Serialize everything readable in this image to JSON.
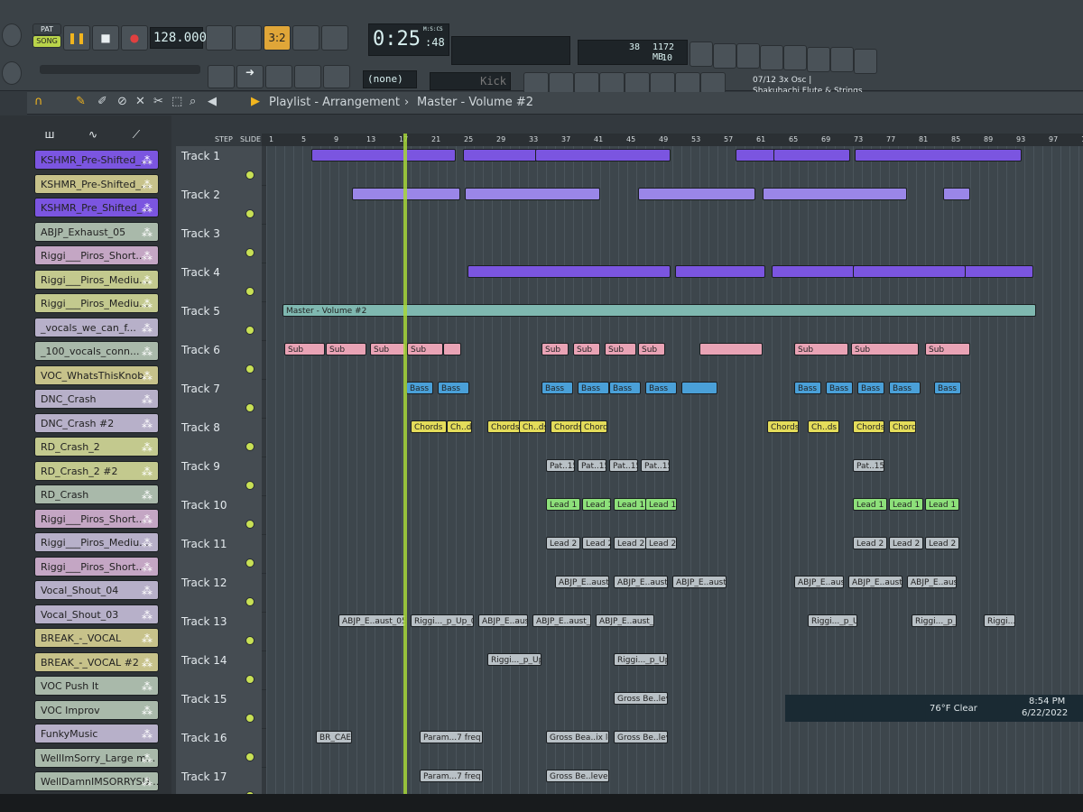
{
  "toolbar": {
    "pat_label": "PAT",
    "song_label": "SONG",
    "tempo": "128.000",
    "time": "0:25",
    "time_ms": ":48",
    "time_unit": "M:S:CS",
    "cpu_value": "38",
    "memory": "1172 MB",
    "polyphony": "10",
    "pattern_select": "(none)",
    "channel_name": "Kick",
    "hint_line1": "07/12  3x Osc |",
    "hint_line2": "Shakuhachi Flute & Strings",
    "step_label": "STEP",
    "slide_label": "SLIDE"
  },
  "playlist": {
    "title": "Playlist - Arrangement",
    "breadcrumb": "Master - Volume #2"
  },
  "browser": {
    "channels": [
      {
        "label": "KSHMR_Pre-Shifted_...",
        "color": "#7b55e0"
      },
      {
        "label": "KSHMR_Pre-Shifted_...",
        "color": "#c7c28a"
      },
      {
        "label": "KSHMR_Pre_Shifted_...",
        "color": "#7b55e0"
      },
      {
        "label": "ABJP_Exhaust_05",
        "color": "#a9b9aa"
      },
      {
        "label": "Riggi___Piros_Short...",
        "color": "#c4a6c4"
      },
      {
        "label": "Riggi___Piros_Mediu...",
        "color": "#c3c98e"
      },
      {
        "label": "Riggi___Piros_Mediu...",
        "color": "#c3c98e"
      },
      {
        "label": "_vocals_we_can_f...",
        "color": "#b7b0c9"
      },
      {
        "label": "_100_vocals_conn...",
        "color": "#a9b9aa"
      },
      {
        "label": "VOC_WhatsThisKnob",
        "color": "#c7c28a"
      },
      {
        "label": "DNC_Crash",
        "color": "#b7b0c9"
      },
      {
        "label": "DNC_Crash #2",
        "color": "#b7b0c9"
      },
      {
        "label": "RD_Crash_2",
        "color": "#c3c98e"
      },
      {
        "label": "RD_Crash_2 #2",
        "color": "#c3c98e"
      },
      {
        "label": "RD_Crash",
        "color": "#a9b9aa"
      },
      {
        "label": "Riggi___Piros_Short...",
        "color": "#c4a6c4"
      },
      {
        "label": "Riggi___Piros_Mediu...",
        "color": "#b7b0c9"
      },
      {
        "label": "Riggi___Piros_Short...",
        "color": "#c4a6c4"
      },
      {
        "label": "Vocal_Shout_04",
        "color": "#b7b0c9"
      },
      {
        "label": "Vocal_Shout_03",
        "color": "#b7b0c9"
      },
      {
        "label": "BREAK_-_VOCAL",
        "color": "#c7c28a"
      },
      {
        "label": "BREAK_-_VOCAL #2",
        "color": "#c7c28a"
      },
      {
        "label": "VOC Push It",
        "color": "#a9b9aa"
      },
      {
        "label": "VOC Improv",
        "color": "#a9b9aa"
      },
      {
        "label": "FunkyMusic",
        "color": "#b7b0c9"
      },
      {
        "label": "WellImSorry_Large m...",
        "color": "#a9b9aa"
      },
      {
        "label": "WellDamnIMSORRYSU...",
        "color": "#a9b9aa"
      }
    ]
  },
  "ruler": [
    "1",
    "5",
    "9",
    "13",
    "17",
    "21",
    "25",
    "29",
    "33",
    "37",
    "41",
    "45",
    "49",
    "53",
    "57",
    "61",
    "65",
    "69",
    "73",
    "77",
    "81",
    "85",
    "89",
    "93",
    "97",
    "10"
  ],
  "tracks": [
    "Track 1",
    "Track 2",
    "Track 3",
    "Track 4",
    "Track 5",
    "Track 6",
    "Track 7",
    "Track 8",
    "Track 9",
    "Track 10",
    "Track 11",
    "Track 12",
    "Track 13",
    "Track 14",
    "Track 15",
    "Track 16",
    "Track 17"
  ],
  "clips": {
    "master_automation": "Master - Volume #2",
    "sub": "Sub",
    "bass": "Bass",
    "chords": "Chords",
    "chords_short": "Ch..ds",
    "pat15": "Pat..15",
    "lead1": "Lead 1",
    "lead2": "Lead 2",
    "abjp": "ABJP_E..aust_05",
    "riggi": "Riggi..._p_Up_05",
    "riggi_short": "Riggi..._p_Up_04",
    "gross1": "Gross Be..level #3",
    "gross2": "Gross Be..level #4",
    "gross3": "Gross Bea..ix level",
    "gross4": "Gross Be..level #2",
    "param": "Param...7 freq",
    "br": "BR_CAE"
  },
  "taskbar": {
    "weather": "76°F  Clear",
    "time": "8:54 PM",
    "date": "6/22/2022"
  },
  "colors": {
    "playhead": "#a6d63a",
    "accent_yellow": "#f2b51e"
  }
}
